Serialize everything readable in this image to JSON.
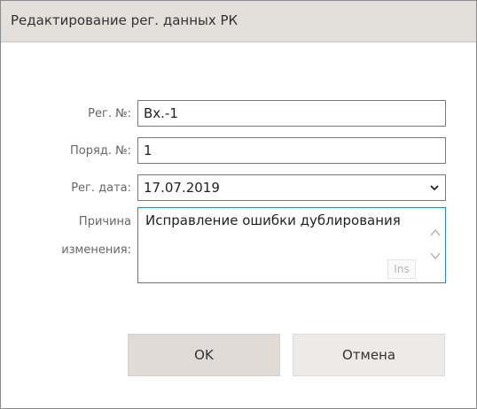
{
  "dialog": {
    "title": "Редактирование рег. данных РК"
  },
  "form": {
    "reg_number": {
      "label": "Рег. №:",
      "value": "Вх.-1"
    },
    "order_number": {
      "label": "Поряд. №:",
      "value": "1"
    },
    "reg_date": {
      "label": "Рег. дата:",
      "value": "17.07.2019"
    },
    "reason": {
      "label_line1": "Причина",
      "label_line2": "изменения:",
      "value": "Исправление ошибки дублирования",
      "ins_badge": "Ins"
    }
  },
  "buttons": {
    "ok_label": "OK",
    "cancel_label": "Отмена"
  },
  "icons": {
    "date_dropdown": "chevron-down-icon",
    "scroll_up": "chevron-up-icon",
    "scroll_down": "chevron-down-icon"
  },
  "colors": {
    "title_bar": "#e3dfda",
    "focus_border": "#2e7fd6",
    "ok_button": "#e0dbd6",
    "cancel_button": "#ecebea"
  }
}
